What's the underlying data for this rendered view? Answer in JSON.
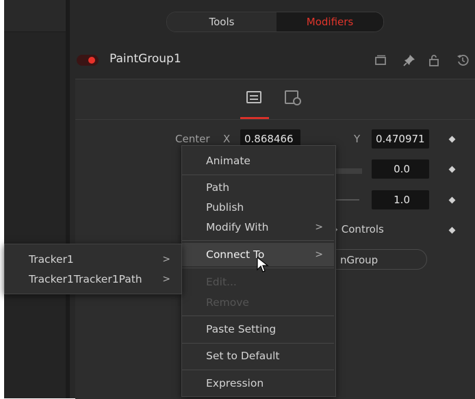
{
  "tabs": {
    "tools": "Tools",
    "modifiers": "Modifiers"
  },
  "tool": {
    "name": "PaintGroup1",
    "enabled": true
  },
  "header_icons": [
    "window-icon",
    "pin-icon",
    "lock-icon",
    "reset-icon"
  ],
  "subtabs": [
    "controls-icon",
    "modifier-icon"
  ],
  "params": {
    "center_label": "Center",
    "x_label": "X",
    "x_value": "0.868466",
    "y_label": "Y",
    "y_value": "0.470971",
    "row2_value": "0.0",
    "row3_value": "1.0",
    "controls_partial": "Controls",
    "group_button_partial": "nGroup"
  },
  "context_menu": {
    "animate": "Animate",
    "path": "Path",
    "publish": "Publish",
    "modify_with": "Modify With",
    "connect_to": "Connect To",
    "edit": "Edit...",
    "remove": "Remove",
    "paste_setting": "Paste Setting",
    "set_to_default": "Set to Default",
    "expression": "Expression"
  },
  "submenu": {
    "items": [
      "Tracker1",
      "Tracker1Tracker1Path"
    ]
  },
  "colors": {
    "accent": "#e0352b",
    "background": "#282828",
    "menu": "#2f2f2f"
  }
}
